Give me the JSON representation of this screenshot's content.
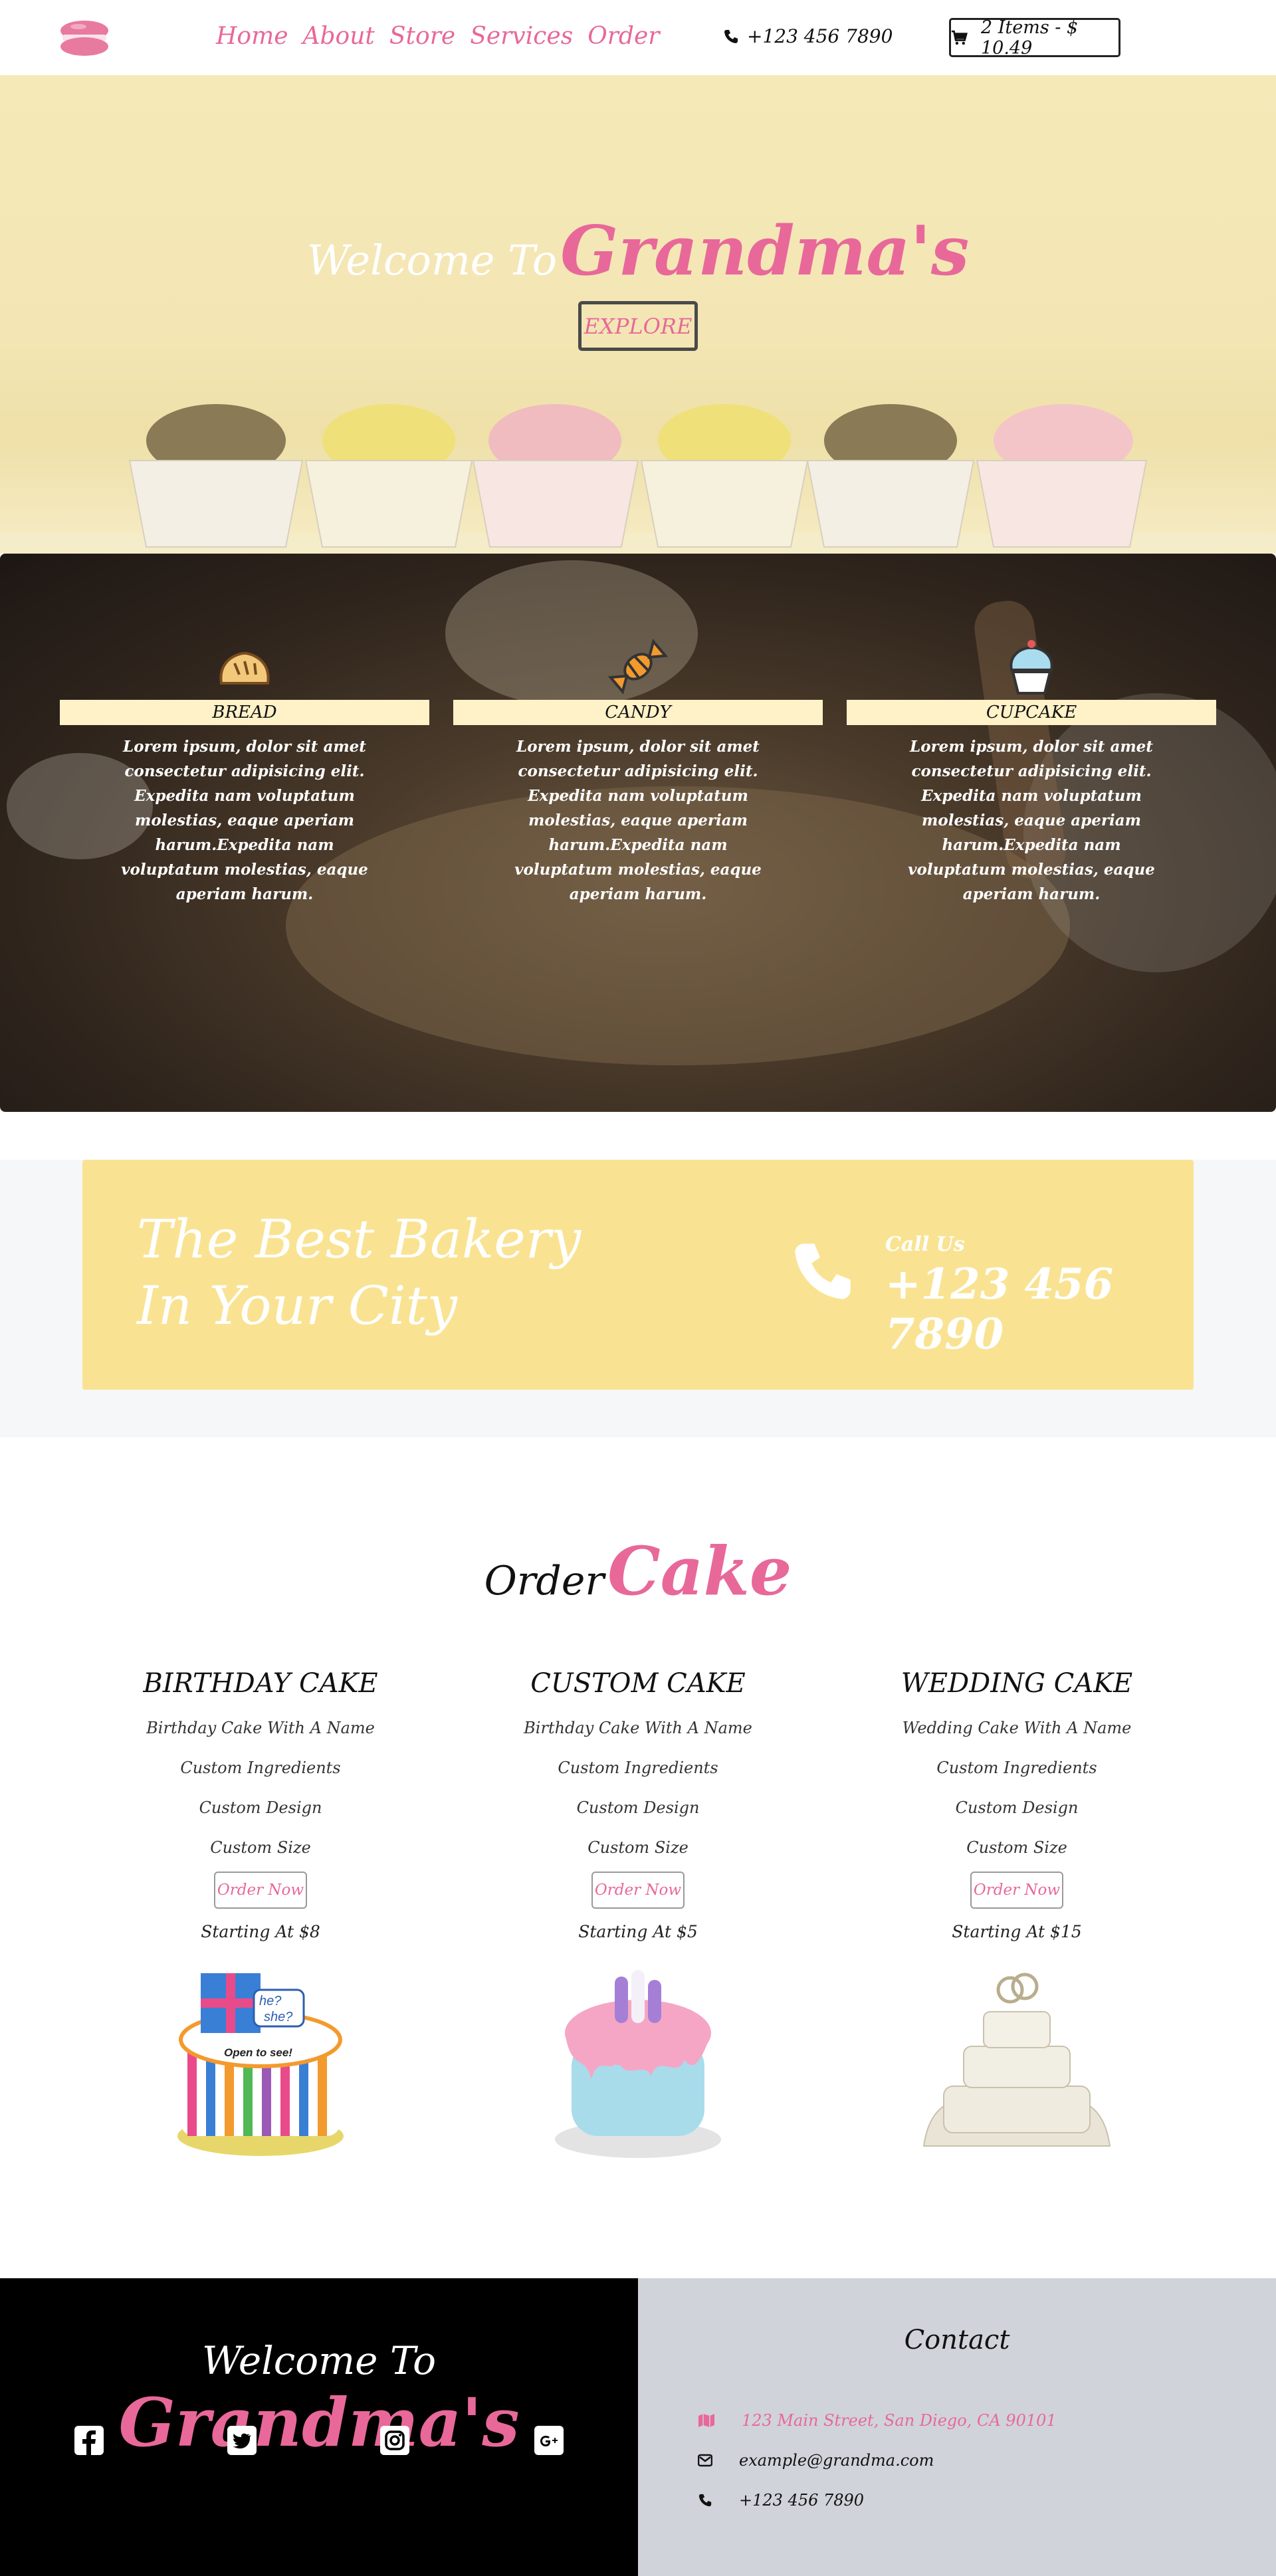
{
  "nav": {
    "links": [
      "Home",
      "About",
      "Store",
      "Services",
      "Order"
    ],
    "phone": "+123 456 7890",
    "cart_label": "2 Items - $ 10.49"
  },
  "hero": {
    "welcome": "Welcome To",
    "brand": "Grandma's",
    "explore": "EXPLORE"
  },
  "features": [
    {
      "label": "BREAD",
      "icon": "bread-icon",
      "text": "Lorem ipsum, dolor sit amet consectetur adipisicing elit. Expedita nam voluptatum molestias, eaque aperiam harum.Expedita nam voluptatum molestias, eaque aperiam harum."
    },
    {
      "label": "CANDY",
      "icon": "candy-icon",
      "text": "Lorem ipsum, dolor sit amet consectetur adipisicing elit. Expedita nam voluptatum molestias, eaque aperiam harum.Expedita nam voluptatum molestias, eaque aperiam harum."
    },
    {
      "label": "CUPCAKE",
      "icon": "cupcake-icon",
      "text": "Lorem ipsum, dolor sit amet consectetur adipisicing elit. Expedita nam voluptatum molestias, eaque aperiam harum.Expedita nam voluptatum molestias, eaque aperiam harum."
    }
  ],
  "best": {
    "title": "The Best Bakery In Your City",
    "call_label": "Call Us",
    "phone": "+123 456 7890"
  },
  "order": {
    "title_1": "Order",
    "title_2": "Cake",
    "cakes": [
      {
        "name": "BIRTHDAY CAKE",
        "items": [
          "Birthday Cake With A Name",
          "Custom Ingredients",
          "Custom Design",
          "Custom Size"
        ],
        "button": "Order Now",
        "price": "Starting At $8"
      },
      {
        "name": "CUSTOM CAKE",
        "items": [
          "Birthday Cake With A Name",
          "Custom Ingredients",
          "Custom Design",
          "Custom Size"
        ],
        "button": "Order Now",
        "price": "Starting At $5"
      },
      {
        "name": "WEDDING CAKE",
        "items": [
          "Wedding Cake With A Name",
          "Custom Ingredients",
          "Custom Design",
          "Custom Size"
        ],
        "button": "Order Now",
        "price": "Starting At $15"
      }
    ],
    "birthday_topper": [
      "he?",
      "she?"
    ],
    "birthday_banner": "Open to see!"
  },
  "footer": {
    "welcome": "Welcome To",
    "brand": "Grandma's",
    "socials": [
      "facebook-icon",
      "twitter-icon",
      "instagram-icon",
      "google-plus-icon"
    ],
    "contact_title": "Contact",
    "address": "123 Main Street, San Diego, CA 90101",
    "email": "example@grandma.com",
    "phone": "+123 456 7890"
  },
  "colors": {
    "accent": "#e8689a",
    "banner": "#f9e393",
    "footer_dark": "#000000",
    "footer_light": "#d0d3da"
  }
}
